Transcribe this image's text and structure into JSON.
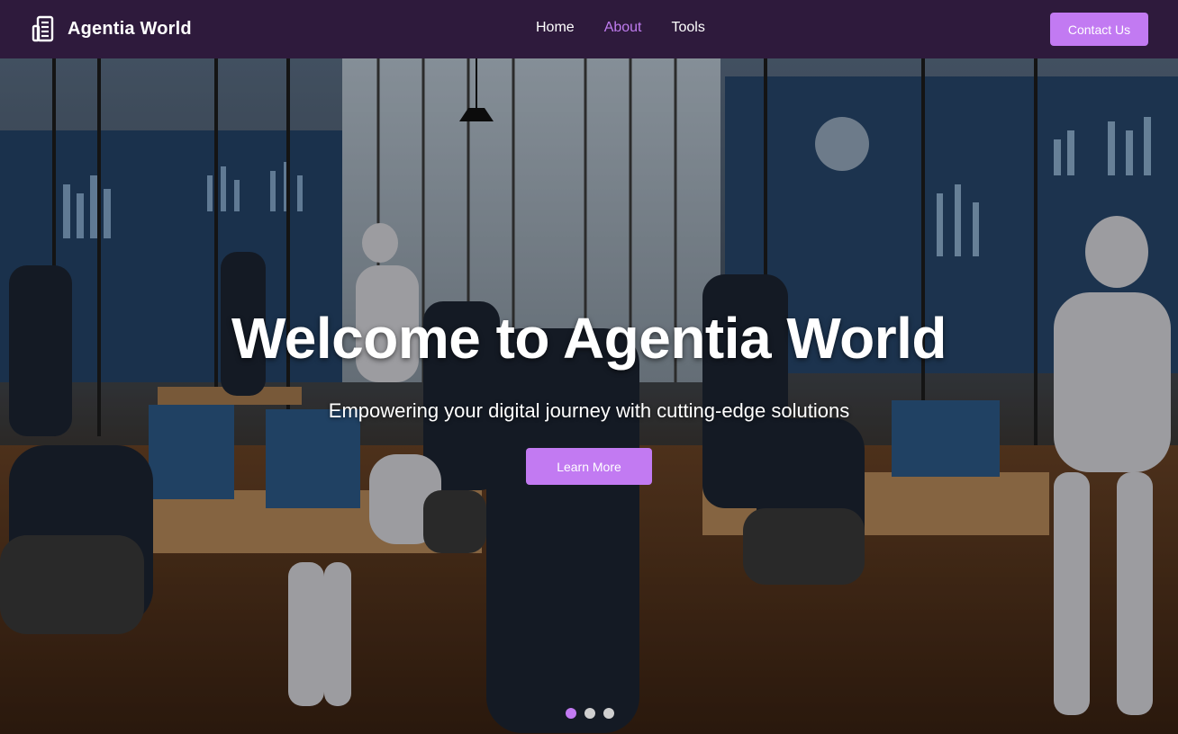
{
  "brand": {
    "name": "Agentia World",
    "icon": "building-icon"
  },
  "nav": {
    "items": [
      {
        "label": "Home",
        "active": false
      },
      {
        "label": "About",
        "active": true
      },
      {
        "label": "Tools",
        "active": false
      }
    ],
    "contact_label": "Contact Us"
  },
  "hero": {
    "title": "Welcome to Agentia World",
    "subtitle": "Empowering your digital journey with cutting-edge solutions",
    "cta_label": "Learn More",
    "slides": {
      "count": 3,
      "active_index": 0
    },
    "image_description": ""
  },
  "colors": {
    "navbar": "#2e1a3c",
    "accent": "#c27af2",
    "active_link": "#c07cf0",
    "inactive_dot": "#cfcfcf"
  }
}
